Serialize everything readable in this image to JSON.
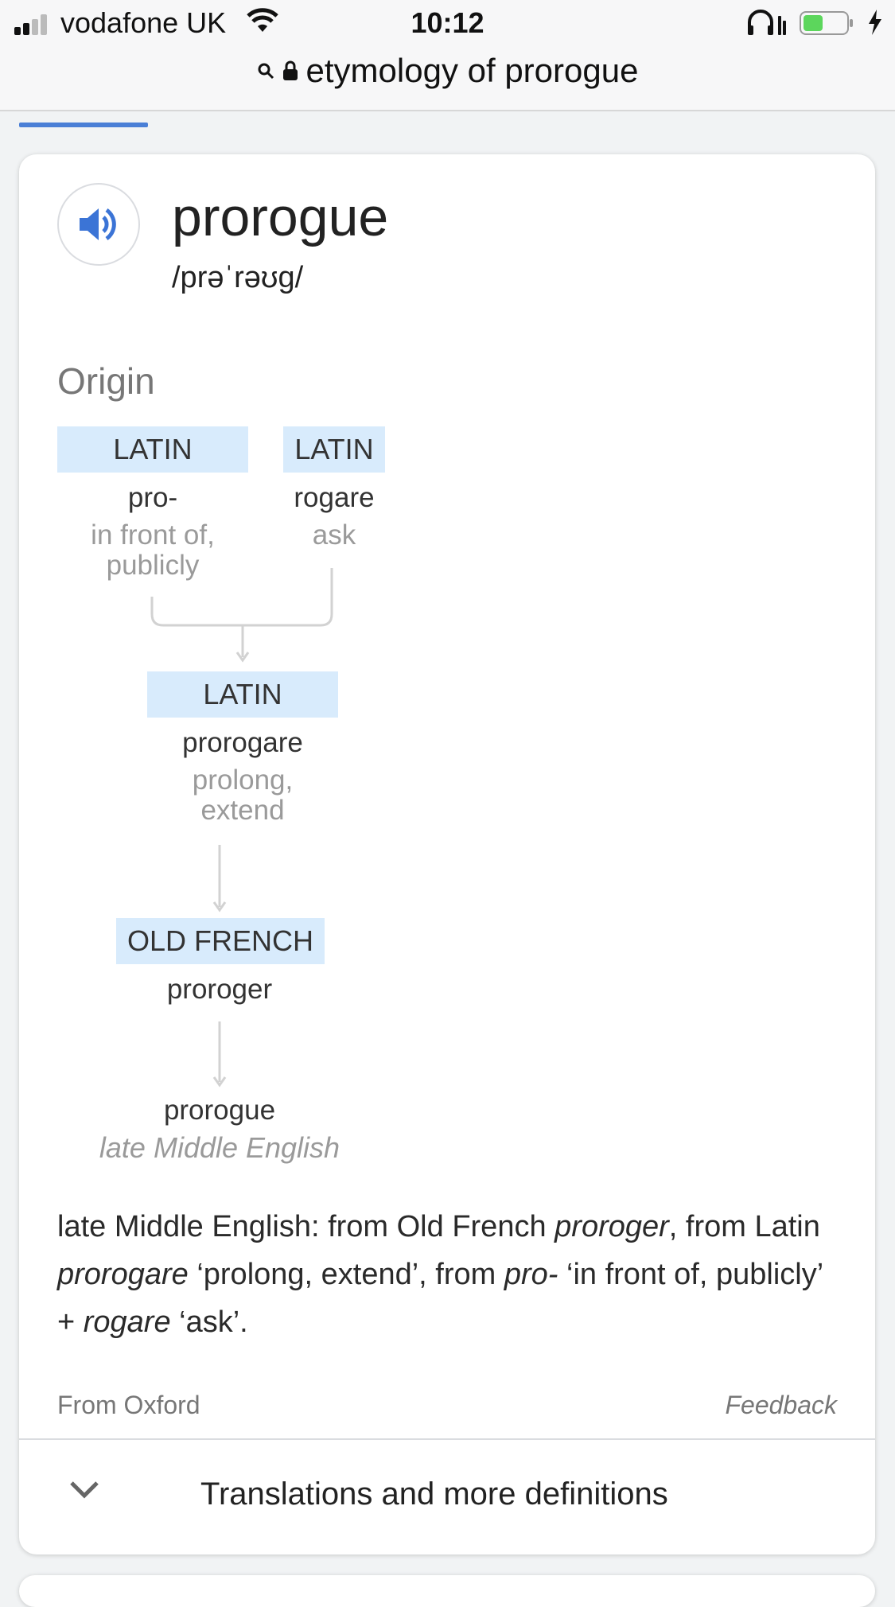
{
  "status": {
    "carrier": "vodafone UK",
    "time": "10:12",
    "battery_color": "#5cd65c"
  },
  "url": {
    "query": "etymology of prorogue"
  },
  "entry": {
    "word": "prorogue",
    "phonetic": "/prəˈrəʊg/",
    "origin_heading": "Origin"
  },
  "tree": {
    "node_latin_pro": {
      "lang": "LATIN",
      "word": "pro-",
      "gloss1": "in front of,",
      "gloss2": "publicly"
    },
    "node_latin_rogare": {
      "lang": "LATIN",
      "word": "rogare",
      "gloss1": "ask"
    },
    "node_latin_prorogare": {
      "lang": "LATIN",
      "word": "prorogare",
      "gloss1": "prolong,",
      "gloss2": "extend"
    },
    "node_old_french": {
      "lang": "OLD FRENCH",
      "word": "proroger"
    },
    "node_final": {
      "word": "prorogue",
      "note": "late Middle English"
    }
  },
  "etymology": {
    "p1": "late Middle English: from Old French ",
    "i1": "proroger",
    "p2": ", from Latin ",
    "i2": "prorogare",
    "p3": " ‘prolong, extend’, from ",
    "i3": "pro-",
    "p4": " ‘in front of, publicly’ + ",
    "i4": "rogare",
    "p5": " ‘ask’."
  },
  "footer": {
    "source": "From Oxford",
    "feedback": "Feedback",
    "more": "Translations and more definitions"
  },
  "colors": {
    "accent": "#4a7fd6",
    "lang_box": "#d8ebfc"
  }
}
